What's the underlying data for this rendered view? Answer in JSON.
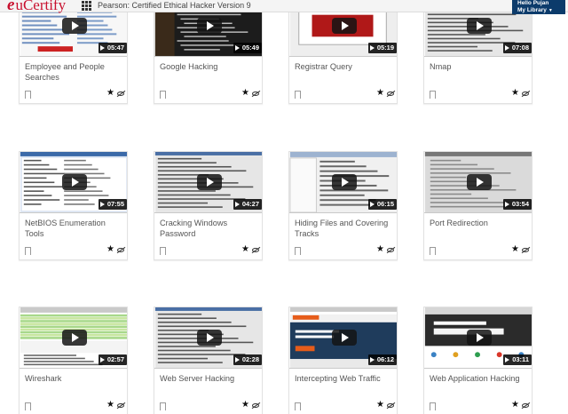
{
  "header": {
    "logo_e": "e",
    "logo_text": "uCertify",
    "apps_icon": "grid-icon",
    "course_title": "Pearson: Certified Ethical Hacker Version 9",
    "user_greeting": "Hello Pujan",
    "user_menu": "My Library"
  },
  "icons": {
    "bookmark": "bookmark-icon",
    "rating": "star-icon",
    "visibility": "eye-slash-icon",
    "play": "play-icon"
  },
  "videos": [
    {
      "title": "Employee and People Searches",
      "duration": "05:47",
      "theme": "web"
    },
    {
      "title": "Google Hacking",
      "duration": "05:49",
      "theme": "dark"
    },
    {
      "title": "Registrar Query",
      "duration": "05:19",
      "theme": "dialog"
    },
    {
      "title": "Nmap",
      "duration": "07:08",
      "theme": "terminal"
    },
    {
      "title": "NetBIOS Enumeration Tools",
      "duration": "07:55",
      "theme": "window"
    },
    {
      "title": "Cracking Windows Password",
      "duration": "04:27",
      "theme": "terminal"
    },
    {
      "title": "Hiding Files and Covering Tracks",
      "duration": "06:15",
      "theme": "explorer"
    },
    {
      "title": "Port Redirection",
      "duration": "03:54",
      "theme": "grey"
    },
    {
      "title": "Wireshark",
      "duration": "02:57",
      "theme": "wireshark"
    },
    {
      "title": "Web Server Hacking",
      "duration": "02:28",
      "theme": "terminal"
    },
    {
      "title": "Intercepting Web Traffic",
      "duration": "06:12",
      "theme": "portswigger"
    },
    {
      "title": "Web Application Hacking",
      "duration": "03:11",
      "theme": "search"
    }
  ],
  "colors": {
    "brand_red": "#c8102e",
    "user_box_bg": "#0c3b6b"
  }
}
